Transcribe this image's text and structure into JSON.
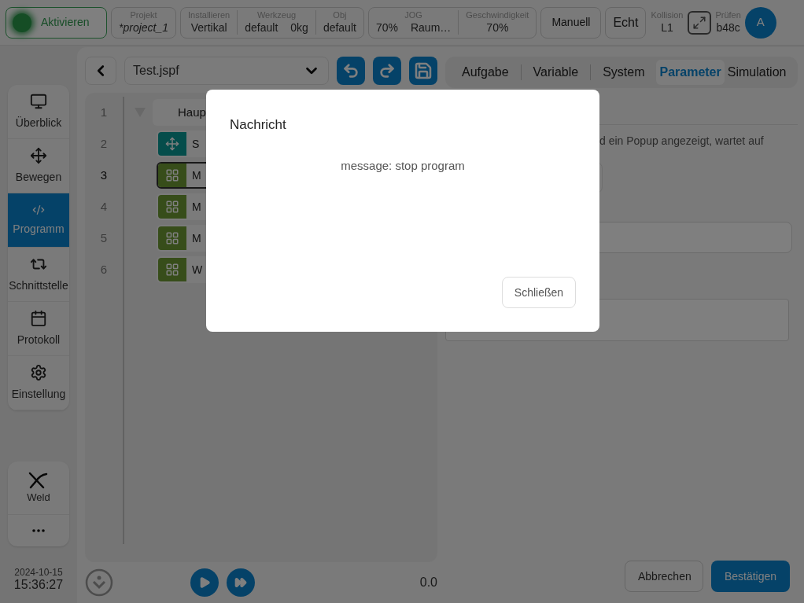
{
  "top_bar": {
    "activate_button": {
      "label": "Aktivieren",
      "on": true
    },
    "groups": [
      {
        "cells": [
          {
            "label": "Projekt",
            "values": [
              "*project_1"
            ]
          }
        ]
      },
      {
        "cells": [
          {
            "label": "Installieren",
            "values": [
              "Vertikal"
            ]
          },
          {
            "label": "Werkzeug",
            "values": [
              "default",
              "0kg"
            ]
          },
          {
            "label": "Obj",
            "values": [
              "default"
            ]
          }
        ]
      },
      {
        "cells": [
          {
            "label": "JOG",
            "values": [
              "70%",
              "Raum…"
            ]
          },
          {
            "label": "Geschwindigkeit",
            "values": [
              "70%"
            ]
          }
        ]
      }
    ],
    "mode_buttons": [
      "Manuell",
      "Echt"
    ],
    "collision": {
      "label": "Kollision",
      "value": "L1"
    },
    "check": {
      "label": "Prüfen",
      "value": "b48c"
    },
    "avatar": "A"
  },
  "sidebar": {
    "items": [
      {
        "label": "Überblick",
        "selected": false
      },
      {
        "label": "Bewegen",
        "selected": false
      },
      {
        "label": "Programm",
        "selected": true
      },
      {
        "label": "Schnittstelle",
        "selected": false
      },
      {
        "label": "Protokoll",
        "selected": false
      },
      {
        "label": "Einstellung",
        "selected": false
      }
    ],
    "extra_items": [
      {
        "label": "Weld"
      }
    ],
    "date": "2024-10-15",
    "time": "15:36:27"
  },
  "editor": {
    "file": "Test.jspf",
    "lines": [
      {
        "number": "1",
        "kind": "header",
        "label": "Haup",
        "expanded": true,
        "selected": false
      },
      {
        "number": "2",
        "kind": "move",
        "label": "S",
        "selected": false
      },
      {
        "number": "3",
        "kind": "block",
        "label": "M",
        "selected": true
      },
      {
        "number": "4",
        "kind": "block",
        "label": "M",
        "selected": false
      },
      {
        "number": "5",
        "kind": "block",
        "label": "M",
        "selected": false
      },
      {
        "number": "6",
        "kind": "block",
        "label": "W",
        "selected": false
      }
    ],
    "value": "0.0"
  },
  "right_panel": {
    "tabs": [
      {
        "label": "Aufgabe",
        "selected": false
      },
      {
        "label": "Variable",
        "selected": false
      },
      {
        "label": "System",
        "selected": false
      },
      {
        "label": "Parameter",
        "selected": true
      },
      {
        "label": "Simulation",
        "selected": false
      }
    ],
    "description": "d ein Popup angezeigt, wartet auf",
    "buttons": [
      "Abbrechen",
      "Bestätigen"
    ]
  },
  "dialog": {
    "title": "Nachricht",
    "message": "message: stop program",
    "button": "Schließen"
  }
}
